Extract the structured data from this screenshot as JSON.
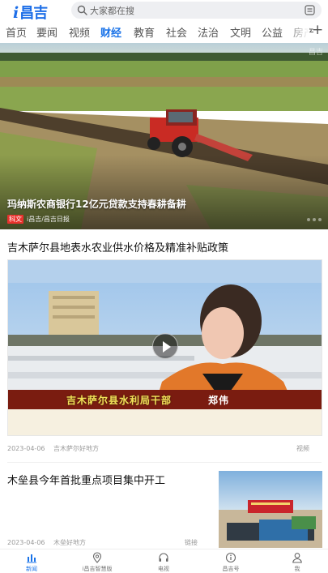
{
  "header": {
    "logo_i": "i",
    "logo_text": "昌吉",
    "search_placeholder": "大家都在搜"
  },
  "tabs": [
    {
      "label": "首页",
      "active": false
    },
    {
      "label": "要闻",
      "active": false
    },
    {
      "label": "视频",
      "active": false
    },
    {
      "label": "财经",
      "active": true
    },
    {
      "label": "教育",
      "active": false
    },
    {
      "label": "社会",
      "active": false
    },
    {
      "label": "法治",
      "active": false
    },
    {
      "label": "文明",
      "active": false
    },
    {
      "label": "公益",
      "active": false
    },
    {
      "label": "房产",
      "active": false
    }
  ],
  "tabs_more": "+",
  "hero": {
    "title": "玛纳斯农商银行12亿元贷款支持春耕备耕",
    "badge": "科文",
    "source": "i昌吉/昌吉日报",
    "watermark": "昌吉"
  },
  "articles": [
    {
      "title": "吉木萨尔县地表水农业供水价格及精准补贴政策",
      "date": "2023-04-06",
      "source": "吉木萨尔好地方",
      "type": "视频",
      "caption": "吉木萨尔县水利局干部",
      "caption_name": "郑伟"
    },
    {
      "title": "木垒县今年首批重点项目集中开工",
      "date": "2023-04-06",
      "source": "木垒好地方",
      "type": "链接"
    }
  ],
  "bottom_nav": [
    {
      "label": "新闻",
      "icon": "bar-chart-icon",
      "active": true
    },
    {
      "label": "i昌吉智慧版",
      "icon": "location-pin-icon",
      "active": false
    },
    {
      "label": "电视",
      "icon": "headphones-icon",
      "active": false
    },
    {
      "label": "昌吉号",
      "icon": "info-circle-icon",
      "active": false
    },
    {
      "label": "我",
      "icon": "user-icon",
      "active": false
    }
  ],
  "colors": {
    "accent": "#1a73e8",
    "badge": "#e8322d"
  }
}
